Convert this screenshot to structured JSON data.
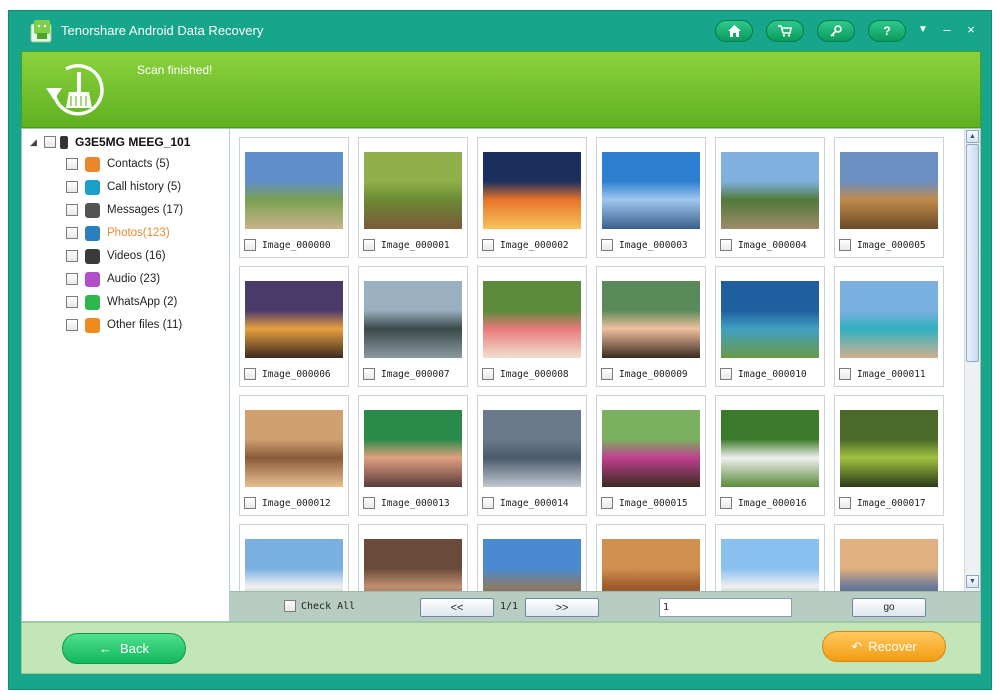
{
  "window": {
    "title": "Tenorshare Android Data Recovery",
    "buttons": [
      "home-icon",
      "cart-icon",
      "key-icon",
      "?"
    ],
    "controls": [
      "▼",
      "–",
      "×"
    ]
  },
  "banner": {
    "status": "Scan finished!"
  },
  "sidebar": {
    "device": "G3E5MG MEEG_101",
    "items": [
      {
        "label": "Contacts (5)",
        "icon": "contacts-icon",
        "color": "#e8882b"
      },
      {
        "label": "Call history (5)",
        "icon": "phone-icon",
        "color": "#1a9fc9"
      },
      {
        "label": "Messages (17)",
        "icon": "message-icon",
        "color": "#555555"
      },
      {
        "label": "Photos(123)",
        "icon": "photo-icon",
        "color": "#2b7fc0",
        "active": true
      },
      {
        "label": "Videos (16)",
        "icon": "video-icon",
        "color": "#3a3a3a"
      },
      {
        "label": "Audio (23)",
        "icon": "audio-icon",
        "color": "#b04fc8"
      },
      {
        "label": "WhatsApp (2)",
        "icon": "whatsapp-icon",
        "color": "#2eb84b"
      },
      {
        "label": "Other files (11)",
        "icon": "other-files-icon",
        "color": "#f08a1c"
      }
    ]
  },
  "images": [
    {
      "name": "Image_000000",
      "colors": [
        "#5f8fc9",
        "#7aa052",
        "#c9b48a"
      ]
    },
    {
      "name": "Image_000001",
      "colors": [
        "#8fb04a",
        "#6b8a34",
        "#7a5a3a"
      ]
    },
    {
      "name": "Image_000002",
      "colors": [
        "#1b2f5e",
        "#e8742a",
        "#f6c45b"
      ]
    },
    {
      "name": "Image_000003",
      "colors": [
        "#2f7fd0",
        "#9fc8f0",
        "#3a5f8a"
      ]
    },
    {
      "name": "Image_000004",
      "colors": [
        "#7fb0e0",
        "#4f7a3a",
        "#a08a6a"
      ]
    },
    {
      "name": "Image_000005",
      "colors": [
        "#6a8fc0",
        "#c08a4a",
        "#6a4a2a"
      ]
    },
    {
      "name": "Image_000006",
      "colors": [
        "#4a3a6a",
        "#e8a040",
        "#3a2a20"
      ]
    },
    {
      "name": "Image_000007",
      "colors": [
        "#9ab0c0",
        "#3a4a4a",
        "#8a9aa0"
      ]
    },
    {
      "name": "Image_000008",
      "colors": [
        "#5a8a3a",
        "#e87a7a",
        "#f0e0d0"
      ]
    },
    {
      "name": "Image_000009",
      "colors": [
        "#5a8a5a",
        "#f0c0a0",
        "#3a2a20"
      ]
    },
    {
      "name": "Image_000010",
      "colors": [
        "#1f5fa0",
        "#3fa0c0",
        "#6a9a4a"
      ]
    },
    {
      "name": "Image_000011",
      "colors": [
        "#7ab0e0",
        "#30b0c0",
        "#d0b090"
      ]
    },
    {
      "name": "Image_000012",
      "colors": [
        "#d0a070",
        "#8a5a3a",
        "#e8c090"
      ]
    },
    {
      "name": "Image_000013",
      "colors": [
        "#2a8a4a",
        "#e0a080",
        "#5a3a3a"
      ]
    },
    {
      "name": "Image_000014",
      "colors": [
        "#6a7a8a",
        "#4a5a6a",
        "#c0c8d0"
      ]
    },
    {
      "name": "Image_000015",
      "colors": [
        "#7ab060",
        "#c04090",
        "#3a2a20"
      ]
    },
    {
      "name": "Image_000016",
      "colors": [
        "#3a7a2a",
        "#f0f0f0",
        "#5a8a3a"
      ]
    },
    {
      "name": "Image_000017",
      "colors": [
        "#4a6a2a",
        "#a0c040",
        "#2a3a1a"
      ]
    },
    {
      "name": "",
      "colors": [
        "#7ab0e0",
        "#f0f0f0",
        "#6a8a4a"
      ]
    },
    {
      "name": "",
      "colors": [
        "#6a4a3a",
        "#c09070",
        "#3a3030"
      ]
    },
    {
      "name": "",
      "colors": [
        "#4a8ad0",
        "#8a7a6a",
        "#5a4a3a"
      ]
    },
    {
      "name": "",
      "colors": [
        "#d09050",
        "#a05a2a",
        "#3a70b0"
      ]
    },
    {
      "name": "",
      "colors": [
        "#8ac0f0",
        "#f0f0f0",
        "#4a7a2a"
      ]
    },
    {
      "name": "",
      "colors": [
        "#e0b080",
        "#6a7a9a",
        "#3a4a3a"
      ]
    }
  ],
  "pager": {
    "check_all": "Check All",
    "prev": "<<",
    "page_info": "1/1",
    "next": ">>",
    "page_value": "1",
    "go": "go"
  },
  "footer": {
    "back": "Back",
    "recover": "Recover"
  },
  "theme": {
    "frame": "#17a58c",
    "banner": "#6fbf2c",
    "back": "#1ec36a",
    "recover": "#f5a623"
  }
}
